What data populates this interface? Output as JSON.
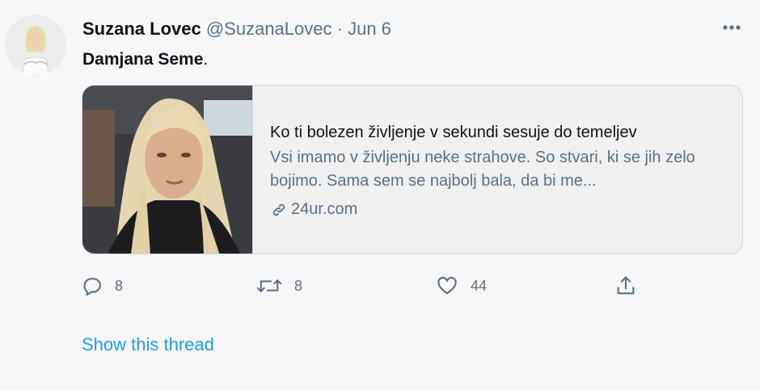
{
  "tweet": {
    "author_name": "Suzana Lovec",
    "author_handle": "@SuzanaLovec",
    "separator": "·",
    "date": "Jun 6",
    "text_bold": "Damjana Seme",
    "text_rest": ".",
    "more_icon": "more-horizontal-icon"
  },
  "card": {
    "title": "Ko ti bolezen življenje v sekundi sesuje do temeljev",
    "description": "Vsi imamo v življenju neke strahove. So stvari, ki se jih zelo bojimo. Sama sem se najbolj bala, da bi me...",
    "domain": "24ur.com",
    "link_icon": "link-icon"
  },
  "actions": {
    "reply_count": "8",
    "retweet_count": "8",
    "like_count": "44"
  },
  "show_thread": "Show this thread",
  "colors": {
    "background": "#f7f7f7",
    "secondary_text": "#5b7083",
    "link_blue": "#1d9bf0",
    "border": "#cfd9de"
  }
}
